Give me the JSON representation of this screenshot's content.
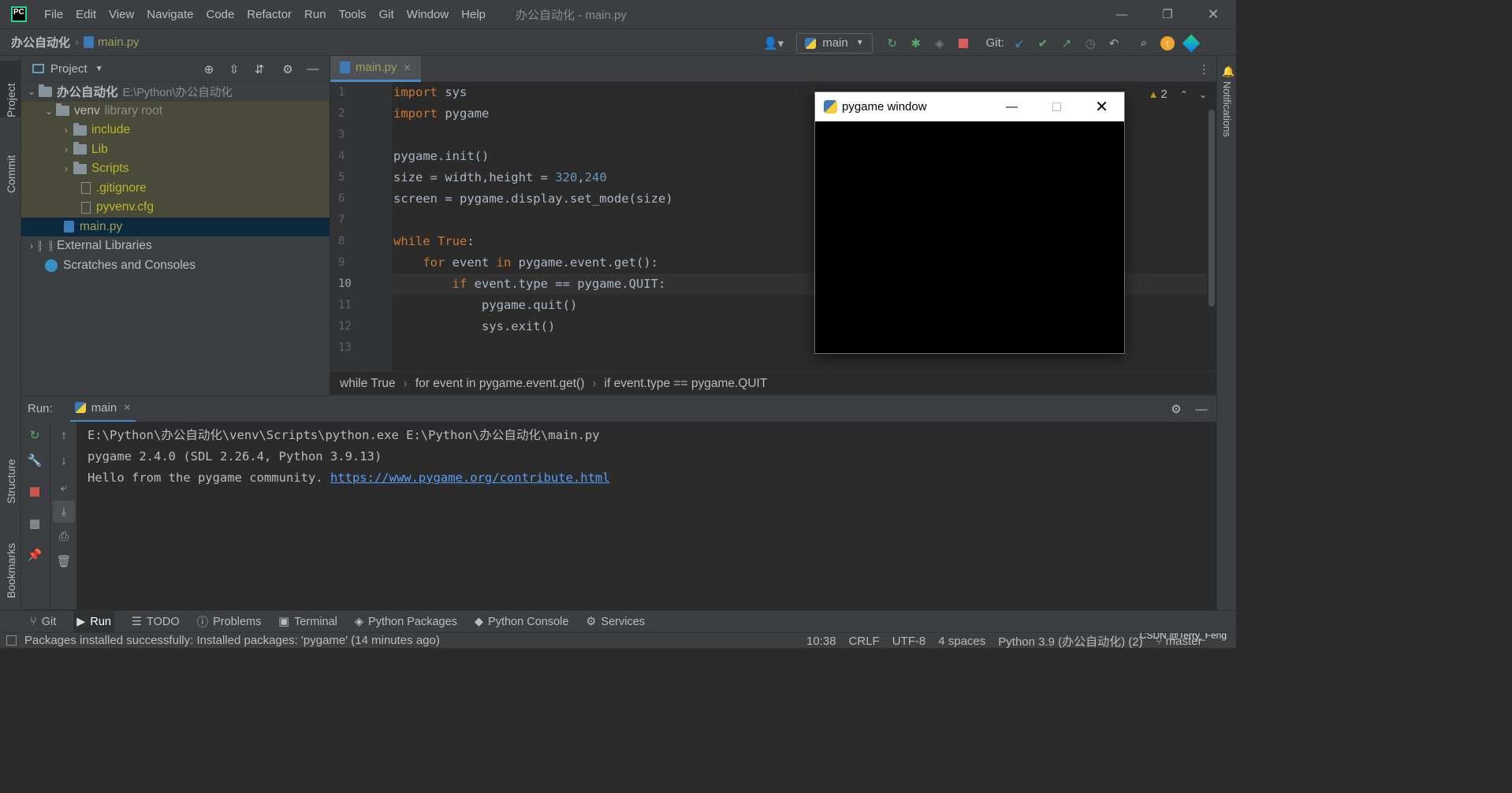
{
  "window": {
    "app_icon": "PC",
    "title": "办公自动化 - main.py",
    "menu": [
      "File",
      "Edit",
      "View",
      "Navigate",
      "Code",
      "Refactor",
      "Run",
      "Tools",
      "Git",
      "Window",
      "Help"
    ]
  },
  "toolbar": {
    "breadcrumb_project": "办公自动化",
    "breadcrumb_file": "main.py",
    "run_config": "main",
    "git_label": "Git:"
  },
  "left_strip": {
    "project": "Project",
    "commit": "Commit",
    "structure": "Structure",
    "bookmarks": "Bookmarks"
  },
  "right_strip": {
    "notifications": "Notifications"
  },
  "project": {
    "header": "Project",
    "tree": {
      "root_name": "办公自动化",
      "root_path": "E:\\Python\\办公自动化",
      "venv_name": "venv",
      "venv_hint": "library root",
      "include": "include",
      "lib": "Lib",
      "scripts": "Scripts",
      "gitignore": ".gitignore",
      "pyvenv": "pyvenv.cfg",
      "main": "main.py",
      "ext_libs": "External Libraries",
      "scratches": "Scratches and Consoles"
    }
  },
  "editor": {
    "tab": "main.py",
    "warning_count": "2",
    "line_numbers": [
      "1",
      "2",
      "3",
      "4",
      "5",
      "6",
      "7",
      "8",
      "9",
      "10",
      "11",
      "12",
      "13"
    ],
    "code": {
      "l1_kw": "import",
      "l1_rest": " sys",
      "l2_kw": "import",
      "l2_rest": " pygame",
      "l4": "pygame.init()",
      "l5_a": "size = width,height = ",
      "l5_n1": "320",
      "l5_c": ",",
      "l5_n2": "240",
      "l6": "screen = pygame.display.set_mode(size)",
      "l8_kw": "while",
      "l8_rest": " True",
      "l8_kw2": ":",
      "l9_kw": "for",
      "l9_a": " event ",
      "l9_kw2": "in",
      "l9_b": " pygame.event.get():",
      "l10_kw": "if",
      "l10_rest": " event.type == pygame.QUIT:",
      "l11": "pygame.quit()",
      "l12": "sys.exit()"
    },
    "breadcrumbs": [
      "while True",
      "for event in pygame.event.get()",
      "if event.type == pygame.QUIT"
    ]
  },
  "run": {
    "label": "Run:",
    "tab": "main",
    "console": {
      "line1": "E:\\Python\\办公自动化\\venv\\Scripts\\python.exe E:\\Python\\办公自动化\\main.py",
      "line2": "pygame 2.4.0 (SDL 2.26.4, Python 3.9.13)",
      "line3_text": "Hello from the pygame community. ",
      "line3_link": "https://www.pygame.org/contribute.html"
    }
  },
  "bottom_tabs": [
    "Git",
    "Run",
    "TODO",
    "Problems",
    "Terminal",
    "Python Packages",
    "Python Console",
    "Services"
  ],
  "status": {
    "message": "Packages installed successfully: Installed packages: 'pygame' (14 minutes ago)",
    "position": "10:38",
    "line_sep": "CRLF",
    "encoding": "UTF-8",
    "indent": "4 spaces",
    "interpreter": "Python 3.9 (办公自动化) (2)",
    "branch": "master",
    "watermark": "CSDN @Terry_Feng"
  },
  "pygame_window": {
    "title": "pygame window"
  }
}
